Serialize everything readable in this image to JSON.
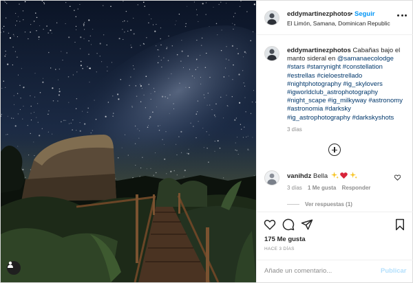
{
  "header": {
    "username": "eddymartinezphotos",
    "separator": "•",
    "follow_label": "Seguir",
    "location": "El Limón, Samana, Dominican Republic"
  },
  "caption": {
    "username": "eddymartinezphotos",
    "text": "Cabañas bajo el manto sideral en",
    "mention": "@samanaecolodge",
    "hashtags": [
      "#stars",
      "#starrynight",
      "#constellation",
      "#estrellas",
      "#cieloestrellado",
      "#nightphotography",
      "#ig_skylovers",
      "#igworldclub_astrophotography",
      "#night_scape",
      "#ig_milkyway",
      "#astronomy",
      "#astronomia",
      "#darksky",
      "#ig_astrophotography",
      "#darkskyshots"
    ],
    "age": "3 días"
  },
  "comments": [
    {
      "username": "vanihdz",
      "text": "Bella",
      "emojis": [
        "sparkle-icon",
        "heart-icon",
        "sparkle-icon"
      ],
      "age": "3 días",
      "likes": "1 Me gusta",
      "reply_label": "Responder",
      "view_replies": "Ver respuestas (1)"
    }
  ],
  "actions": {
    "icons": [
      "heart-outline-icon",
      "comment-icon",
      "share-icon",
      "bookmark-icon"
    ],
    "likes": "175 Me gusta",
    "date": "HACE 3 DÍAS"
  },
  "add_comment": {
    "placeholder": "Añade un comentario...",
    "post_label": "Publicar"
  },
  "colors": {
    "link_blue": "#0095f6",
    "hashtag_blue": "#00376b",
    "muted": "#8e8e8e",
    "post_disabled": "#b2dffc",
    "emoji_heart": "#d8243a",
    "emoji_sparkle": "#f6c21b"
  }
}
